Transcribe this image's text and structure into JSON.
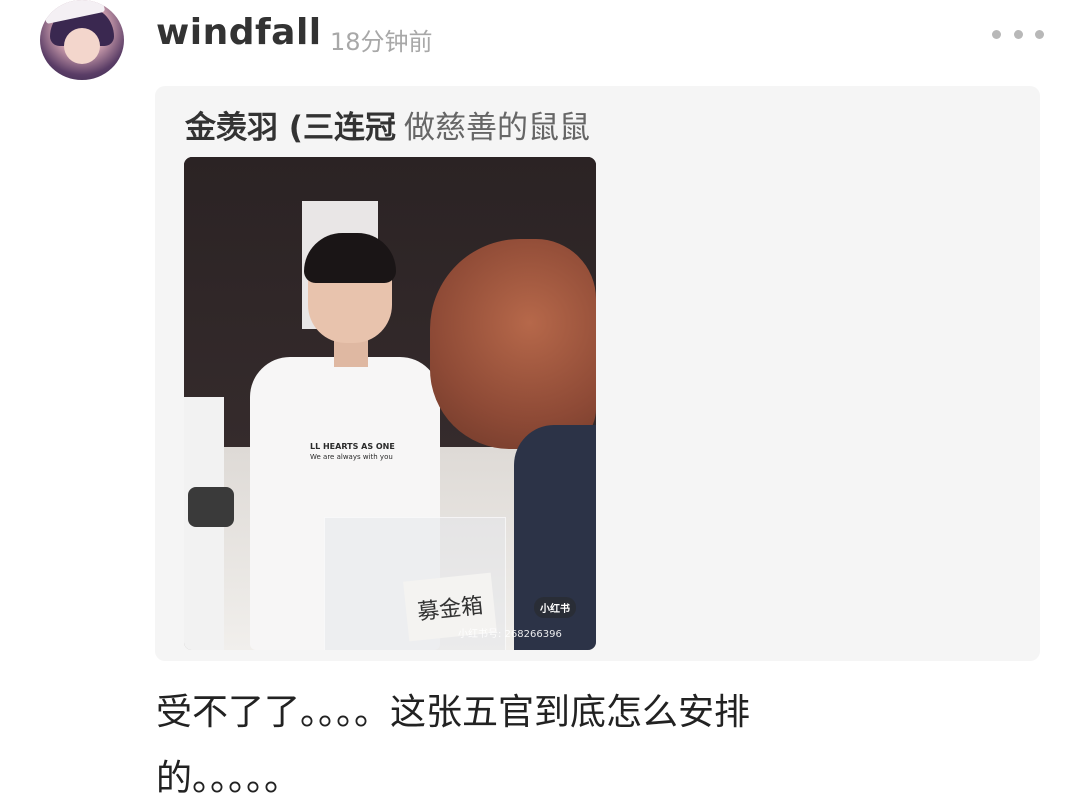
{
  "comment": {
    "username": "windfall",
    "timestamp": "18分钟前",
    "text": "受不了了。。。。这张五官到底怎么安排的。。。。。"
  },
  "quote": {
    "author": "金羡羽 (三连冠",
    "text": "做慈善的鼠鼠",
    "image": {
      "shirt_text_line1": "LL HEARTS AS ONE",
      "shirt_text_line2": "We are always with you",
      "box_label": "募金箱",
      "watermark_badge": "小红书",
      "watermark_id": "小红书号: 268266396"
    }
  },
  "icons": {
    "more": "more-dots-icon",
    "avatar": "user-avatar"
  },
  "colors": {
    "username": "#333333",
    "timestamp": "#a8a8a8",
    "quote_background": "#f5f5f5",
    "quote_text": "#666666",
    "body_text": "#222222"
  }
}
